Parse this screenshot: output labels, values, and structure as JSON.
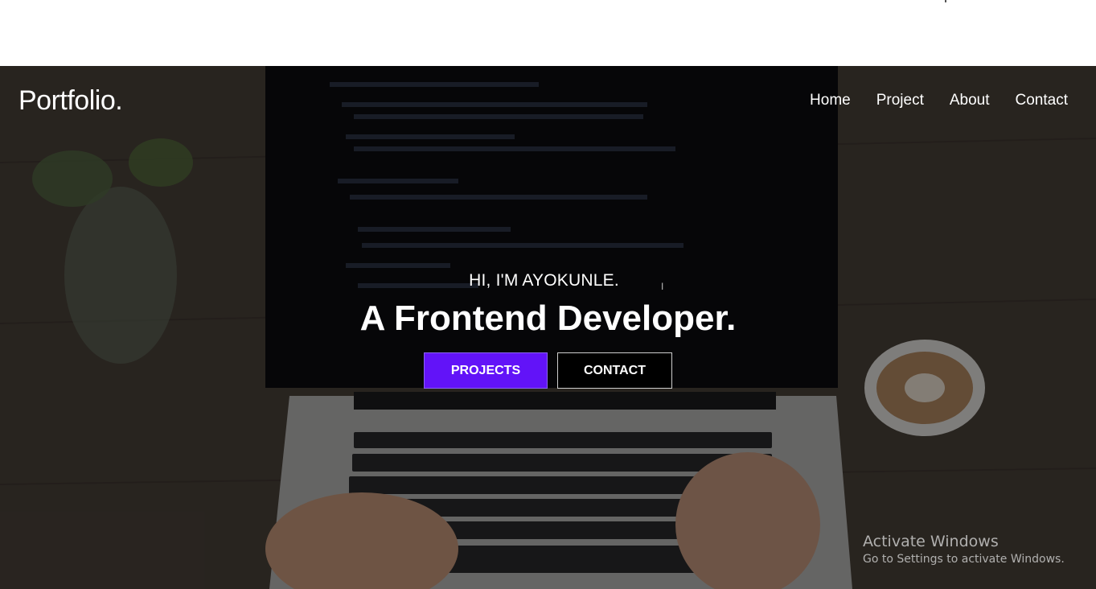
{
  "header": {
    "logo": "Portfolio."
  },
  "nav": {
    "items": [
      "Home",
      "Project",
      "About",
      "Contact"
    ]
  },
  "hero": {
    "greeting": "HI, I'M AYOKUNLE.",
    "headline": "A Frontend Developer.",
    "primary_button": "PROJECTS",
    "secondary_button": "CONTACT"
  },
  "watermark": {
    "title": "Activate Windows",
    "subtitle": "Go to Settings to activate Windows."
  },
  "colors": {
    "accent": "#6213f8",
    "background": "#000000",
    "text": "#ffffff"
  }
}
